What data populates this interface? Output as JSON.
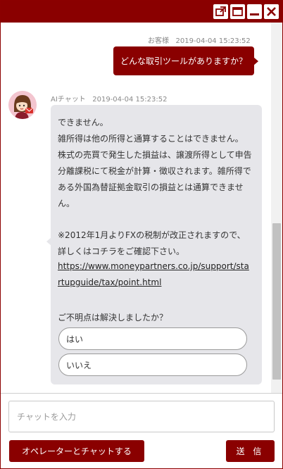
{
  "titlebar": {
    "buttons": [
      {
        "icon": "popout-icon"
      },
      {
        "icon": "maximize-icon"
      },
      {
        "icon": "minimize-icon"
      },
      {
        "icon": "close-icon"
      }
    ],
    "color": "#8a0000"
  },
  "messages": {
    "user": {
      "sender": "お客様",
      "timestamp": "2019-04-04 15:23:52",
      "text": "どんな取引ツールがありますか？"
    },
    "bot": {
      "sender": "AIチャット",
      "timestamp": "2019-04-04 15:23:52",
      "lines": [
        "できません。",
        "雑所得は他の所得と通算することはできません。",
        "株式の売買で発生した損益は、譲渡所得として申告",
        "分離課税にて税金が計算・徴収されます。雑所得で",
        "ある外国為替証拠金取引の損益とは通算できませ",
        "ん。",
        "※2012年1月よりFXの税制が改正されますので、",
        "詳しくはコチラをご確認下さい。",
        "https://www.moneypartners.co.jp/support/sta",
        "rtupguide/tax/point.html",
        "ご不明点は解決しましたか？"
      ],
      "choices": [
        "はい",
        "いいえ"
      ]
    }
  },
  "input": {
    "placeholder": "チャットを入力"
  },
  "footer": {
    "operator_label": "オペレーターとチャットする",
    "send_label": "送 信"
  }
}
